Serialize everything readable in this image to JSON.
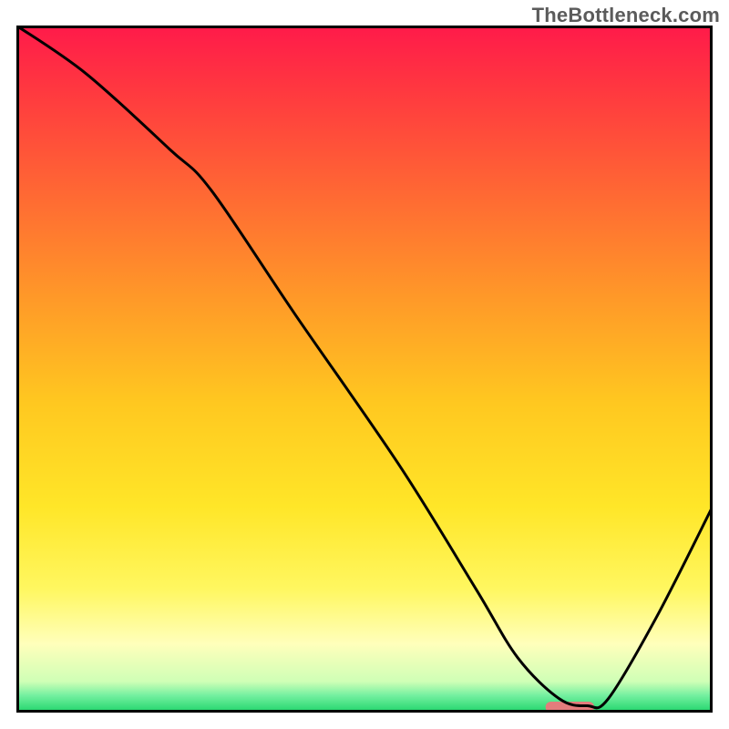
{
  "watermark": "TheBottleneck.com",
  "chart_data": {
    "type": "line",
    "title": "",
    "xlabel": "",
    "ylabel": "",
    "xlim": [
      0,
      100
    ],
    "ylim": [
      0,
      100
    ],
    "legend": false,
    "grid": false,
    "background_gradient": {
      "stops": [
        {
          "y_normalized": 0.0,
          "color": "#ff1a4a"
        },
        {
          "y_normalized": 0.1,
          "color": "#ff3a3f"
        },
        {
          "y_normalized": 0.25,
          "color": "#ff6a33"
        },
        {
          "y_normalized": 0.4,
          "color": "#ff9a28"
        },
        {
          "y_normalized": 0.55,
          "color": "#ffc820"
        },
        {
          "y_normalized": 0.7,
          "color": "#ffe628"
        },
        {
          "y_normalized": 0.82,
          "color": "#fff760"
        },
        {
          "y_normalized": 0.9,
          "color": "#ffffbb"
        },
        {
          "y_normalized": 0.955,
          "color": "#cfffb6"
        },
        {
          "y_normalized": 0.975,
          "color": "#74f0a0"
        },
        {
          "y_normalized": 1.0,
          "color": "#1fd46a"
        }
      ]
    },
    "series": [
      {
        "name": "bottleneck-curve",
        "color": "#000000",
        "x": [
          0,
          10,
          22,
          28,
          40,
          55,
          66,
          72,
          78,
          82,
          85,
          92,
          100
        ],
        "values": [
          100,
          93,
          82,
          76,
          58,
          36,
          18,
          8,
          2,
          1,
          2,
          14,
          30
        ]
      }
    ],
    "marker": {
      "name": "optimal-range",
      "x_center": 79.5,
      "width": 7,
      "y": 0.8,
      "color": "#e37c7c"
    }
  }
}
